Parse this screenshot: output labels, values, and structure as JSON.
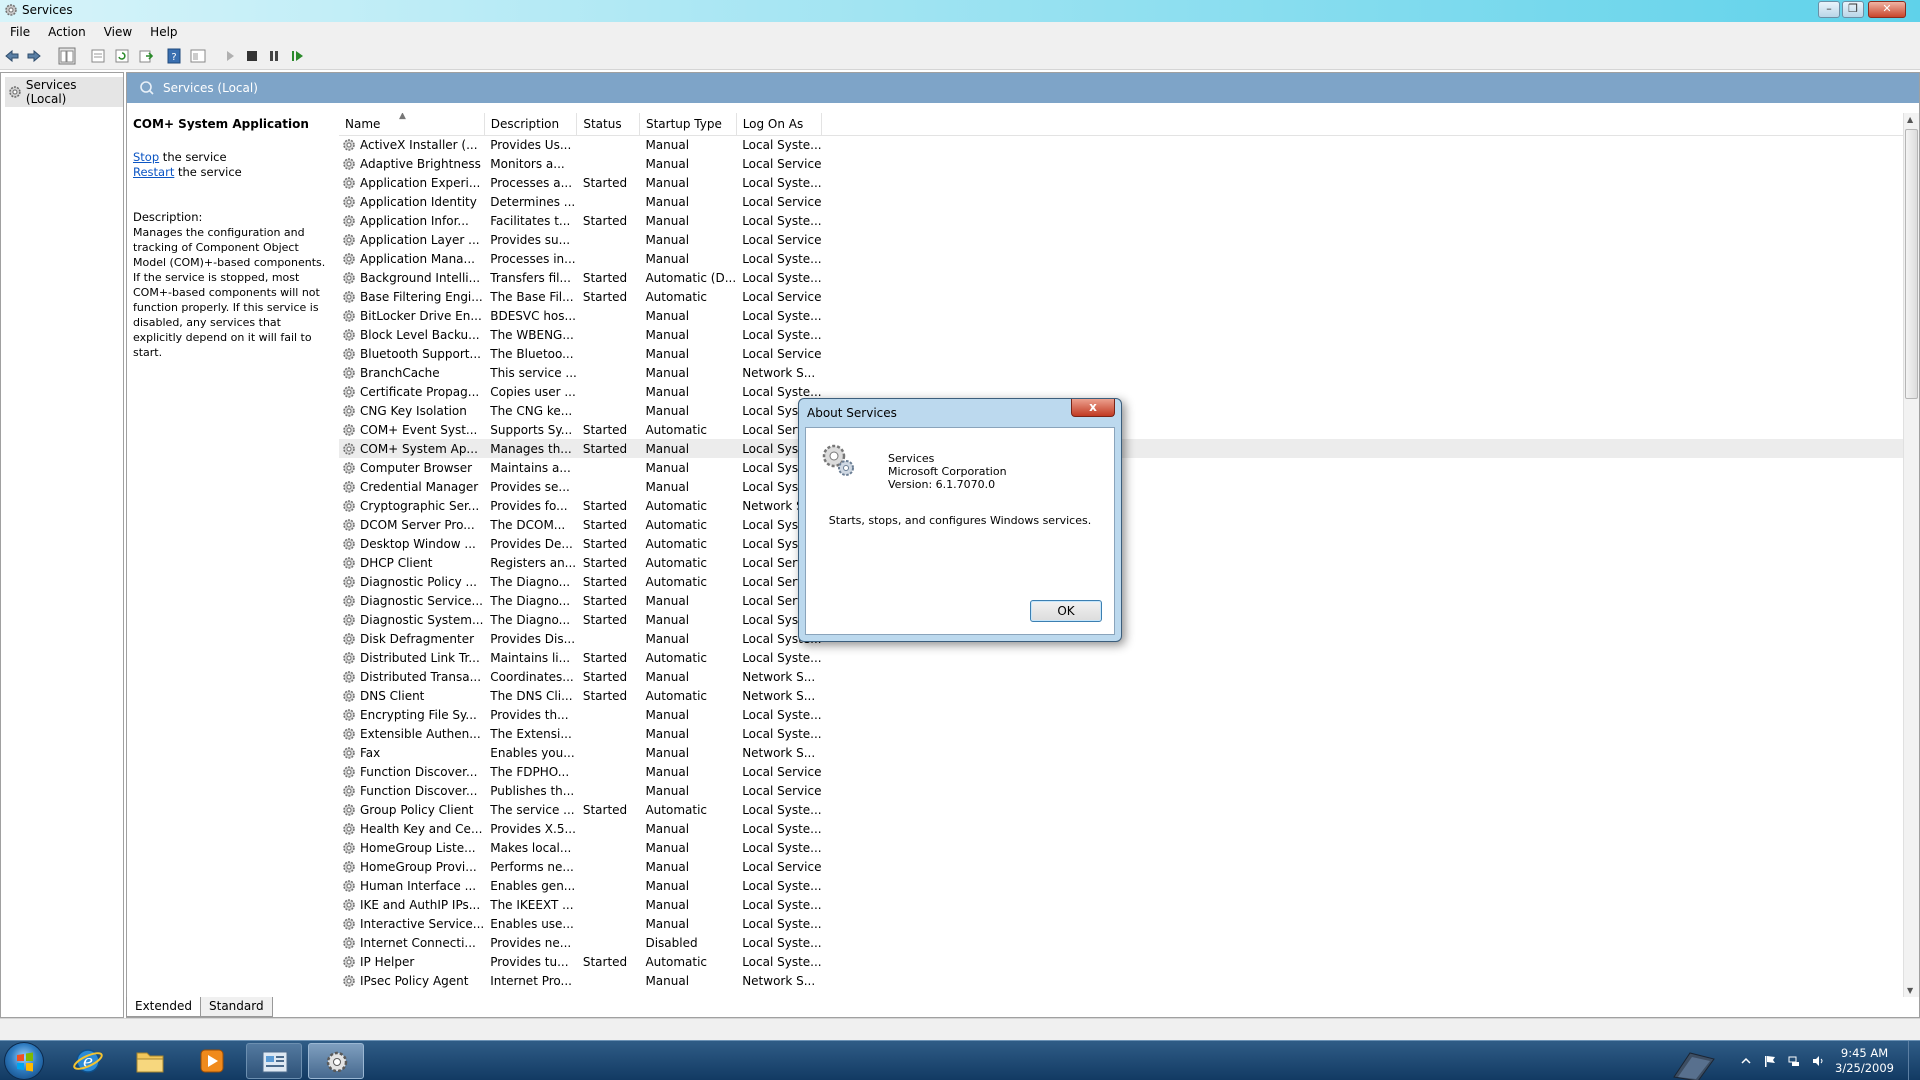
{
  "window": {
    "title": "Services"
  },
  "menu": [
    "File",
    "Action",
    "View",
    "Help"
  ],
  "tree": {
    "root": "Services (Local)"
  },
  "pane": {
    "header": "Services (Local)"
  },
  "details": {
    "service_name": "COM+ System Application",
    "stop_link": "Stop",
    "stop_rest": " the service",
    "restart_link": "Restart",
    "restart_rest": " the service",
    "description_label": "Description:",
    "description": "Manages the configuration and tracking of Component Object Model (COM)+-based components. If the service is stopped, most COM+-based components will not function properly. If this service is disabled, any services that explicitly depend on it will fail to start."
  },
  "table": {
    "columns": [
      "Name",
      "Description",
      "Status",
      "Startup Type",
      "Log On As"
    ],
    "selected_index": 16,
    "rows": [
      [
        "ActiveX Installer (...",
        "Provides Us...",
        "",
        "Manual",
        "Local Syste..."
      ],
      [
        "Adaptive Brightness",
        "Monitors a...",
        "",
        "Manual",
        "Local Service"
      ],
      [
        "Application Experi...",
        "Processes a...",
        "Started",
        "Manual",
        "Local Syste..."
      ],
      [
        "Application Identity",
        "Determines ...",
        "",
        "Manual",
        "Local Service"
      ],
      [
        "Application Infor...",
        "Facilitates t...",
        "Started",
        "Manual",
        "Local Syste..."
      ],
      [
        "Application Layer ...",
        "Provides su...",
        "",
        "Manual",
        "Local Service"
      ],
      [
        "Application Mana...",
        "Processes in...",
        "",
        "Manual",
        "Local Syste..."
      ],
      [
        "Background Intelli...",
        "Transfers fil...",
        "Started",
        "Automatic (D...",
        "Local Syste..."
      ],
      [
        "Base Filtering Engi...",
        "The Base Fil...",
        "Started",
        "Automatic",
        "Local Service"
      ],
      [
        "BitLocker Drive En...",
        "BDESVC hos...",
        "",
        "Manual",
        "Local Syste..."
      ],
      [
        "Block Level Backu...",
        "The WBENG...",
        "",
        "Manual",
        "Local Syste..."
      ],
      [
        "Bluetooth Support...",
        "The Bluetoo...",
        "",
        "Manual",
        "Local Service"
      ],
      [
        "BranchCache",
        "This service ...",
        "",
        "Manual",
        "Network S..."
      ],
      [
        "Certificate Propag...",
        "Copies user ...",
        "",
        "Manual",
        "Local Syste..."
      ],
      [
        "CNG Key Isolation",
        "The CNG ke...",
        "",
        "Manual",
        "Local Syste..."
      ],
      [
        "COM+ Event Syst...",
        "Supports Sy...",
        "Started",
        "Automatic",
        "Local Service"
      ],
      [
        "COM+ System Ap...",
        "Manages th...",
        "Started",
        "Manual",
        "Local Syste..."
      ],
      [
        "Computer Browser",
        "Maintains a...",
        "",
        "Manual",
        "Local Syste..."
      ],
      [
        "Credential Manager",
        "Provides se...",
        "",
        "Manual",
        "Local Syste..."
      ],
      [
        "Cryptographic Ser...",
        "Provides fo...",
        "Started",
        "Automatic",
        "Network S..."
      ],
      [
        "DCOM Server Pro...",
        "The DCOM...",
        "Started",
        "Automatic",
        "Local Syste..."
      ],
      [
        "Desktop Window ...",
        "Provides De...",
        "Started",
        "Automatic",
        "Local Syste..."
      ],
      [
        "DHCP Client",
        "Registers an...",
        "Started",
        "Automatic",
        "Local Service"
      ],
      [
        "Diagnostic Policy ...",
        "The Diagno...",
        "Started",
        "Automatic",
        "Local Service"
      ],
      [
        "Diagnostic Service...",
        "The Diagno...",
        "Started",
        "Manual",
        "Local Service"
      ],
      [
        "Diagnostic System...",
        "The Diagno...",
        "Started",
        "Manual",
        "Local Syste..."
      ],
      [
        "Disk Defragmenter",
        "Provides Dis...",
        "",
        "Manual",
        "Local Syste..."
      ],
      [
        "Distributed Link Tr...",
        "Maintains li...",
        "Started",
        "Automatic",
        "Local Syste..."
      ],
      [
        "Distributed Transa...",
        "Coordinates...",
        "Started",
        "Manual",
        "Network S..."
      ],
      [
        "DNS Client",
        "The DNS Cli...",
        "Started",
        "Automatic",
        "Network S..."
      ],
      [
        "Encrypting File Sy...",
        "Provides th...",
        "",
        "Manual",
        "Local Syste..."
      ],
      [
        "Extensible Authen...",
        "The Extensi...",
        "",
        "Manual",
        "Local Syste..."
      ],
      [
        "Fax",
        "Enables you...",
        "",
        "Manual",
        "Network S..."
      ],
      [
        "Function Discover...",
        "The FDPHO...",
        "",
        "Manual",
        "Local Service"
      ],
      [
        "Function Discover...",
        "Publishes th...",
        "",
        "Manual",
        "Local Service"
      ],
      [
        "Group Policy Client",
        "The service ...",
        "Started",
        "Automatic",
        "Local Syste..."
      ],
      [
        "Health Key and Ce...",
        "Provides X.5...",
        "",
        "Manual",
        "Local Syste..."
      ],
      [
        "HomeGroup Liste...",
        "Makes local...",
        "",
        "Manual",
        "Local Syste..."
      ],
      [
        "HomeGroup Provi...",
        "Performs ne...",
        "",
        "Manual",
        "Local Service"
      ],
      [
        "Human Interface ...",
        "Enables gen...",
        "",
        "Manual",
        "Local Syste..."
      ],
      [
        "IKE and AuthIP IPs...",
        "The IKEEXT ...",
        "",
        "Manual",
        "Local Syste..."
      ],
      [
        "Interactive Service...",
        "Enables use...",
        "",
        "Manual",
        "Local Syste..."
      ],
      [
        "Internet Connecti...",
        "Provides ne...",
        "",
        "Disabled",
        "Local Syste..."
      ],
      [
        "IP Helper",
        "Provides tu...",
        "Started",
        "Automatic",
        "Local Syste..."
      ],
      [
        "IPsec Policy Agent",
        "Internet Pro...",
        "",
        "Manual",
        "Network S..."
      ]
    ]
  },
  "tabs": [
    "Extended",
    "Standard"
  ],
  "dialog": {
    "title": "About Services",
    "close": "x",
    "product": "Services",
    "company": "Microsoft Corporation",
    "version": "Version: 6.1.7070.0",
    "description": "Starts, stops, and configures Windows services.",
    "ok": "OK"
  },
  "taskbar": {
    "time": "9:45 AM",
    "date": "3/25/2009",
    "apps": [
      "internet-explorer-icon",
      "explorer-folder-icon",
      "media-player-icon",
      "control-panel-icon",
      "services-icon"
    ]
  },
  "colors": {
    "pane_header": "#7ea4c8",
    "selected_row": "#ececec",
    "link": "#0b55c4",
    "taskbar": "#1f4a75"
  }
}
